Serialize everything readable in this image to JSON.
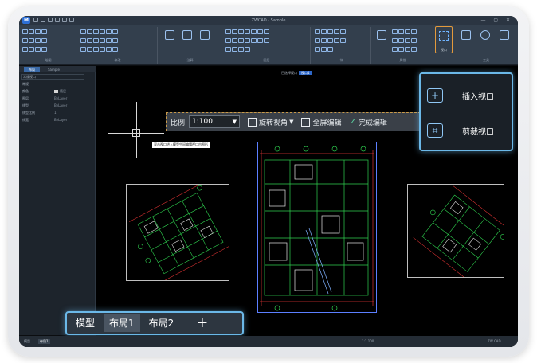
{
  "titlebar": {
    "logo": "M",
    "title": "ZWCAD - Sample"
  },
  "ribbon": {
    "groups": [
      "绘图",
      "修改",
      "注释",
      "图层",
      "块",
      "属性",
      "视口",
      "工具"
    ],
    "viewport_tool_label": "视口"
  },
  "panel_tabs": {
    "active": "布局",
    "other": "Sample"
  },
  "properties": {
    "dropdown": "常规视口",
    "section": "常规",
    "rows": [
      {
        "k": "颜色",
        "v": "随层"
      },
      {
        "k": "图层",
        "v": "ByLayer"
      },
      {
        "k": "线型",
        "v": "ByLayer"
      },
      {
        "k": "线型比例",
        "v": "1"
      },
      {
        "k": "线宽",
        "v": "ByLayer"
      }
    ]
  },
  "canvas": {
    "viewport_status_prefix": "已选择视口",
    "viewport_status_value": "视口1"
  },
  "viewport_toolbar": {
    "scale_label": "比例:",
    "scale_value": "1:100",
    "rotate_label": "旋转视角",
    "fullscreen_label": "全屏编辑",
    "done_label": "完成编辑"
  },
  "hint": "双击视口进入模型空间编辑视口内图形",
  "popup": {
    "insert_label": "插入视口",
    "clip_label": "剪裁视口"
  },
  "layout_tabs": {
    "model": "模型",
    "layout1": "布局1",
    "layout2": "布局2",
    "add": "+"
  },
  "statusbar": {
    "left": "模型",
    "tab1": "布局1",
    "coords": "1:1 100",
    "right": "ZW CAD"
  },
  "colors": {
    "accent": "#6bb8e8",
    "selection": "#e39a3c",
    "viewport_active": "#5c7fff"
  }
}
